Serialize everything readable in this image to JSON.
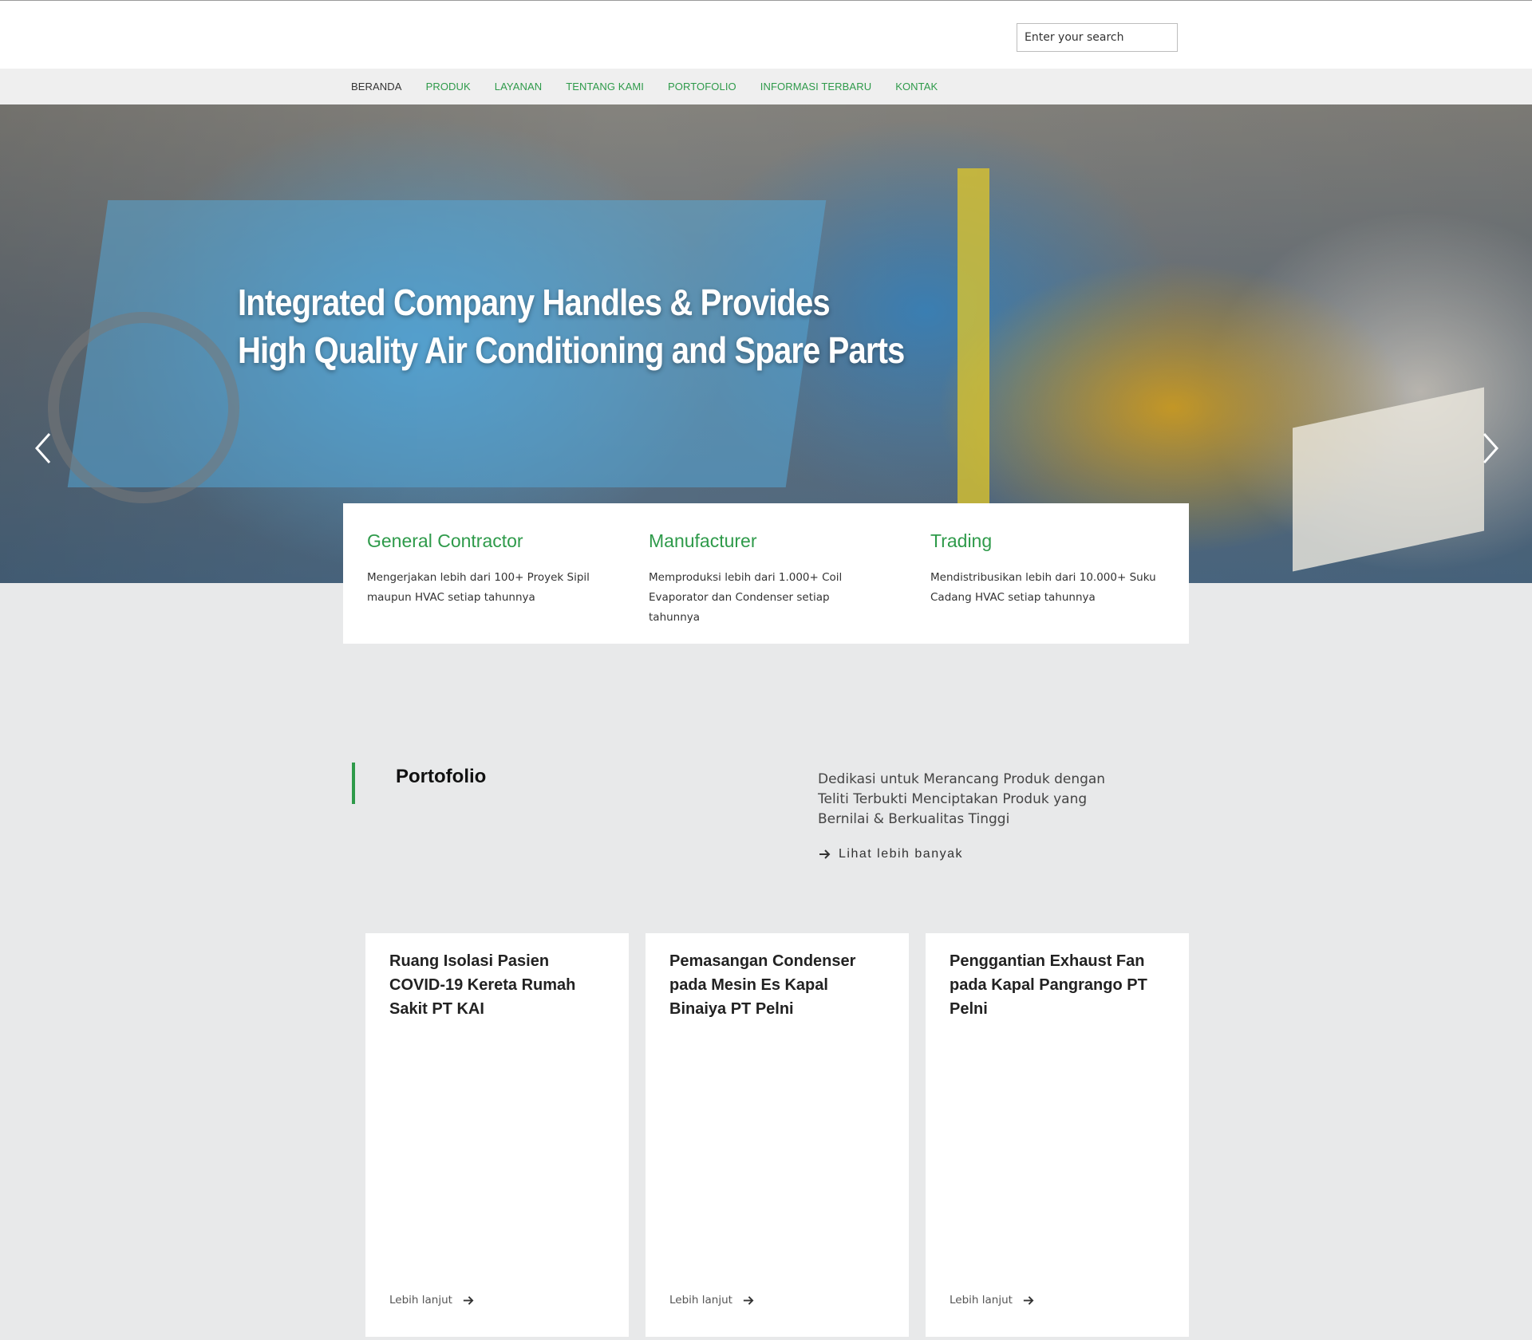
{
  "search": {
    "placeholder": "Enter your search"
  },
  "nav": {
    "items": [
      {
        "label": "BERANDA"
      },
      {
        "label": "PRODUK"
      },
      {
        "label": "LAYANAN"
      },
      {
        "label": "TENTANG KAMI"
      },
      {
        "label": "PORTOFOLIO"
      },
      {
        "label": "INFORMASI TERBARU"
      },
      {
        "label": "KONTAK"
      }
    ]
  },
  "hero": {
    "title_line1": "Integrated Company Handles & Provides",
    "title_line2": "High Quality Air Conditioning and Spare Parts",
    "prev_icon": "chevron-left-icon",
    "next_icon": "chevron-right-icon"
  },
  "features": [
    {
      "title": "General Contractor",
      "text": "Mengerjakan lebih dari 100+ Proyek Sipil maupun HVAC setiap tahunnya"
    },
    {
      "title": "Manufacturer",
      "text": "Memproduksi lebih dari 1.000+ Coil Evaporator dan Condenser setiap tahunnya"
    },
    {
      "title": "Trading",
      "text": "Mendistribusikan lebih dari 10.000+ Suku Cadang HVAC setiap tahunnya"
    }
  ],
  "portfolio": {
    "title": "Portofolio",
    "description": "Dedikasi untuk Merancang Produk dengan Teliti Terbukti Menciptakan Produk yang Bernilai & Berkualitas Tinggi",
    "more_label": "Lihat lebih banyak",
    "cards": [
      {
        "title": "Ruang Isolasi Pasien COVID-19 Kereta Rumah Sakit PT KAI",
        "link": "Lebih lanjut"
      },
      {
        "title": "Pemasangan Condenser pada Mesin Es Kapal Binaiya PT Pelni",
        "link": "Lebih lanjut"
      },
      {
        "title": "Penggantian Exhaust Fan pada Kapal Pangrango PT Pelni",
        "link": "Lebih lanjut"
      }
    ]
  },
  "colors": {
    "accent": "#2e9a4a",
    "page_bg": "#e8e9ea",
    "nav_bg": "#efefef"
  }
}
